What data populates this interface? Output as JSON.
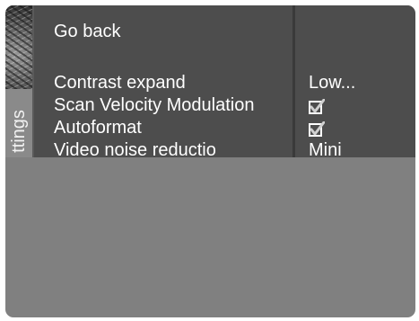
{
  "side_tab": {
    "label": "ttings"
  },
  "menu": {
    "go_back_label": "Go back",
    "items": [
      {
        "label": "Contrast expand",
        "value": "Low..."
      },
      {
        "label": "Scan Velocity Modulation",
        "checked": true,
        "value_icon": "checkbox-checked-icon"
      },
      {
        "label": "Autoformat",
        "checked": true,
        "value_icon": "checkbox-checked-icon"
      },
      {
        "label": "Video noise reductio",
        "value": "Mini"
      }
    ]
  },
  "colors": {
    "menu_background": "#4d4d4d",
    "lower_area": "#808080",
    "text": "#ffffff",
    "side_tab": "#8a8a8a"
  }
}
